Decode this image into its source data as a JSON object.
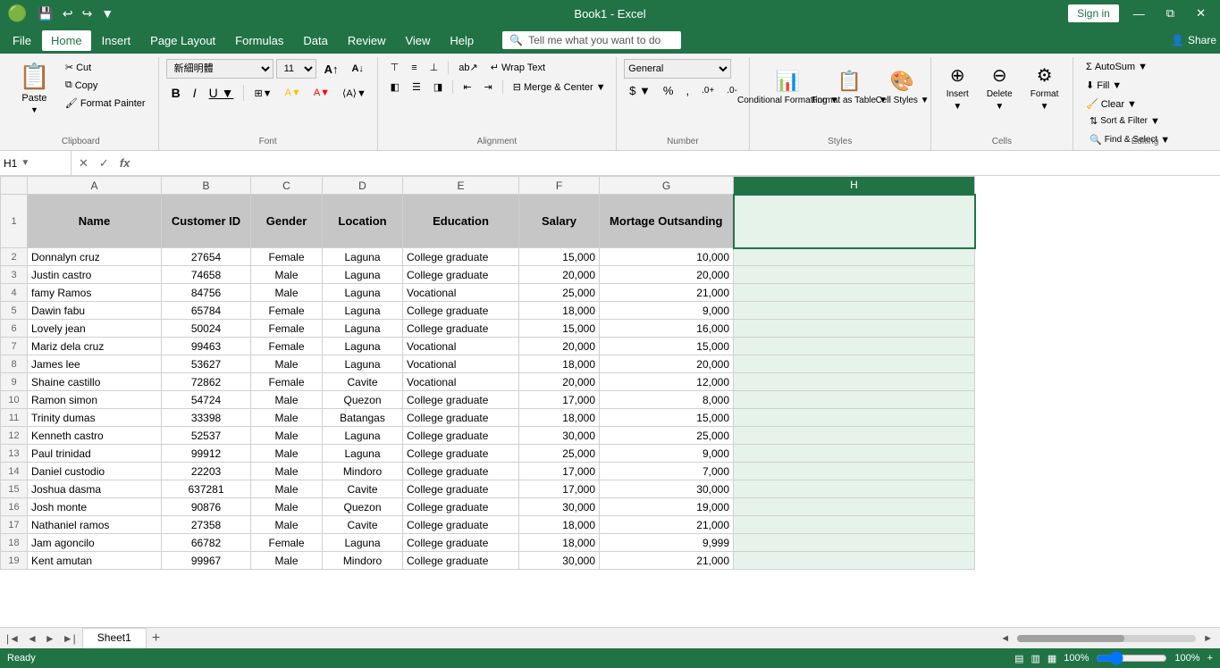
{
  "titleBar": {
    "quickAccess": [
      "💾",
      "↩",
      "↪",
      "▼"
    ],
    "title": "Book1 - Excel",
    "signIn": "Sign in",
    "windowButtons": [
      "—",
      "⧉",
      "✕"
    ]
  },
  "menuBar": {
    "items": [
      "File",
      "Home",
      "Insert",
      "Page Layout",
      "Formulas",
      "Data",
      "Review",
      "View",
      "Help"
    ],
    "active": "Home",
    "search": "Tell me what you want to do",
    "share": "Share"
  },
  "ribbon": {
    "clipboard": {
      "label": "Clipboard",
      "paste": "Paste",
      "cut": "Cut",
      "copy": "Copy",
      "formatPainter": "Format Painter"
    },
    "font": {
      "label": "Font",
      "fontName": "新細明體",
      "fontSize": "11",
      "bold": "B",
      "italic": "I",
      "underline": "U",
      "border": "⊞",
      "fillColor": "Fill Color",
      "fontColor": "Font Color",
      "increaseFont": "A",
      "decreaseFont": "A"
    },
    "alignment": {
      "label": "Alignment",
      "wrapText": "Wrap Text",
      "mergeCenter": "Merge & Center",
      "alignTop": "⊤",
      "alignMiddle": "≡",
      "alignBottom": "⊥",
      "alignLeft": "◧",
      "alignCenter": "◫",
      "alignRight": "◨",
      "indent": "⇥",
      "outdent": "⇤",
      "orientation": "ab"
    },
    "number": {
      "label": "Number",
      "format": "General",
      "currency": "$",
      "percent": "%",
      "comma": ",",
      "increaseDecimal": "+.0",
      "decreaseDecimal": "-.0"
    },
    "styles": {
      "label": "Styles",
      "conditionalFormatting": "Conditional Formatting",
      "formatAsTable": "Format as Table",
      "cellStyles": "Cell Styles"
    },
    "cells": {
      "label": "Cells",
      "insert": "Insert",
      "delete": "Delete",
      "format": "Format"
    },
    "editing": {
      "label": "Editing",
      "autoSum": "AutoSum",
      "fill": "Fill",
      "clear": "Clear",
      "sortFilter": "Sort & Filter",
      "findSelect": "Find & Select"
    }
  },
  "formulaBar": {
    "nameBox": "H1",
    "cancelBtn": "✕",
    "confirmBtn": "✓",
    "insertFn": "fx",
    "formula": ""
  },
  "columns": {
    "rowHeader": "",
    "A": "A",
    "B": "B",
    "C": "C",
    "D": "D",
    "E": "E",
    "F": "F",
    "G": "G",
    "H": "H"
  },
  "headers": {
    "name": "Name",
    "customerId": "Customer ID",
    "gender": "Gender",
    "location": "Location",
    "education": "Education",
    "salary": "Salary",
    "mortgage": "Mortage Outsanding"
  },
  "rows": [
    {
      "row": 2,
      "name": "Donnalyn cruz",
      "customerId": "27654",
      "gender": "Female",
      "location": "Laguna",
      "education": "College graduate",
      "salary": "15,000",
      "mortgage": "10,000"
    },
    {
      "row": 3,
      "name": "Justin castro",
      "customerId": "74658",
      "gender": "Male",
      "location": "Laguna",
      "education": "College graduate",
      "salary": "20,000",
      "mortgage": "20,000"
    },
    {
      "row": 4,
      "name": "famy Ramos",
      "customerId": "84756",
      "gender": "Male",
      "location": "Laguna",
      "education": "Vocational",
      "salary": "25,000",
      "mortgage": "21,000"
    },
    {
      "row": 5,
      "name": "Dawin fabu",
      "customerId": "65784",
      "gender": "Female",
      "location": "Laguna",
      "education": "College graduate",
      "salary": "18,000",
      "mortgage": "9,000"
    },
    {
      "row": 6,
      "name": "Lovely jean",
      "customerId": "50024",
      "gender": "Female",
      "location": "Laguna",
      "education": "College graduate",
      "salary": "15,000",
      "mortgage": "16,000"
    },
    {
      "row": 7,
      "name": "Mariz dela cruz",
      "customerId": "99463",
      "gender": "Female",
      "location": "Laguna",
      "education": "Vocational",
      "salary": "20,000",
      "mortgage": "15,000"
    },
    {
      "row": 8,
      "name": "James lee",
      "customerId": "53627",
      "gender": "Male",
      "location": "Laguna",
      "education": "Vocational",
      "salary": "18,000",
      "mortgage": "20,000"
    },
    {
      "row": 9,
      "name": "Shaine castillo",
      "customerId": "72862",
      "gender": "Female",
      "location": "Cavite",
      "education": "Vocational",
      "salary": "20,000",
      "mortgage": "12,000"
    },
    {
      "row": 10,
      "name": "Ramon simon",
      "customerId": "54724",
      "gender": "Male",
      "location": "Quezon",
      "education": "College graduate",
      "salary": "17,000",
      "mortgage": "8,000"
    },
    {
      "row": 11,
      "name": "Trinity dumas",
      "customerId": "33398",
      "gender": "Male",
      "location": "Batangas",
      "education": "College graduate",
      "salary": "18,000",
      "mortgage": "15,000"
    },
    {
      "row": 12,
      "name": "Kenneth castro",
      "customerId": "52537",
      "gender": "Male",
      "location": "Laguna",
      "education": "College graduate",
      "salary": "30,000",
      "mortgage": "25,000"
    },
    {
      "row": 13,
      "name": "Paul trinidad",
      "customerId": "99912",
      "gender": "Male",
      "location": "Laguna",
      "education": "College graduate",
      "salary": "25,000",
      "mortgage": "9,000"
    },
    {
      "row": 14,
      "name": "Daniel custodio",
      "customerId": "22203",
      "gender": "Male",
      "location": "Mindoro",
      "education": "College graduate",
      "salary": "17,000",
      "mortgage": "7,000"
    },
    {
      "row": 15,
      "name": "Joshua dasma",
      "customerId": "637281",
      "gender": "Male",
      "location": "Cavite",
      "education": "College graduate",
      "salary": "17,000",
      "mortgage": "30,000"
    },
    {
      "row": 16,
      "name": "Josh monte",
      "customerId": "90876",
      "gender": "Male",
      "location": "Quezon",
      "education": "College graduate",
      "salary": "30,000",
      "mortgage": "19,000"
    },
    {
      "row": 17,
      "name": "Nathaniel ramos",
      "customerId": "27358",
      "gender": "Male",
      "location": "Cavite",
      "education": "College graduate",
      "salary": "18,000",
      "mortgage": "21,000"
    },
    {
      "row": 18,
      "name": "Jam agoncilo",
      "customerId": "66782",
      "gender": "Female",
      "location": "Laguna",
      "education": "College graduate",
      "salary": "18,000",
      "mortgage": "9,999"
    },
    {
      "row": 19,
      "name": "Kent amutan",
      "customerId": "99967",
      "gender": "Male",
      "location": "Mindoro",
      "education": "College graduate",
      "salary": "30,000",
      "mortgage": "21,000"
    }
  ],
  "statusBar": {
    "ready": "Ready",
    "views": [
      "normal",
      "layout",
      "page-break"
    ],
    "zoom": "100%"
  },
  "sheetTabs": {
    "tabs": [
      "Sheet1"
    ],
    "addBtn": "+"
  }
}
